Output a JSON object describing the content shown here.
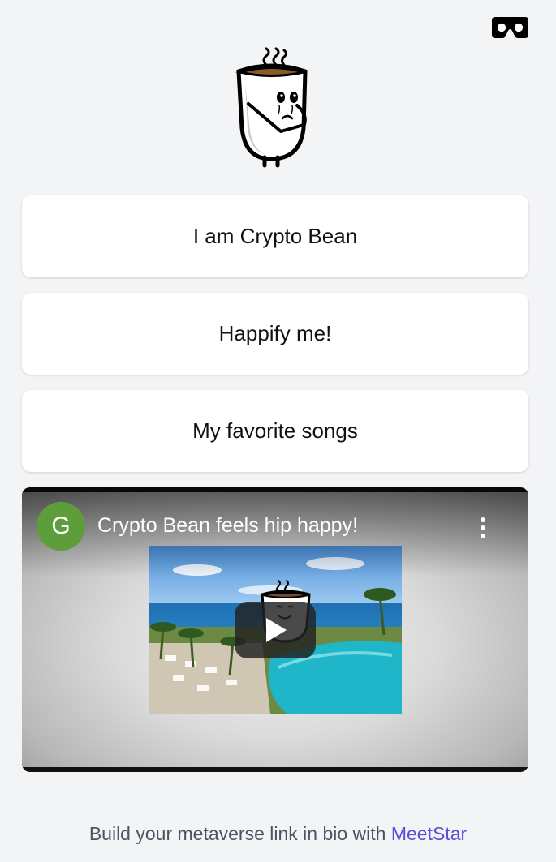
{
  "header": {
    "vr_icon": "vr-headset-icon"
  },
  "profile": {
    "avatar_icon": "coffee-cup-character"
  },
  "links": [
    {
      "label": "I am Crypto Bean"
    },
    {
      "label": "Happify me!"
    },
    {
      "label": "My favorite songs"
    }
  ],
  "video": {
    "channel_initial": "G",
    "channel_color": "#5e9e3a",
    "title": "Crypto Bean feels hip happy!",
    "menu_icon": "more-vertical-icon",
    "play_icon": "play-icon"
  },
  "footer": {
    "text": "Build your metaverse link in bio with ",
    "brand": "MeetStar",
    "brand_color": "#5b4fd8"
  }
}
